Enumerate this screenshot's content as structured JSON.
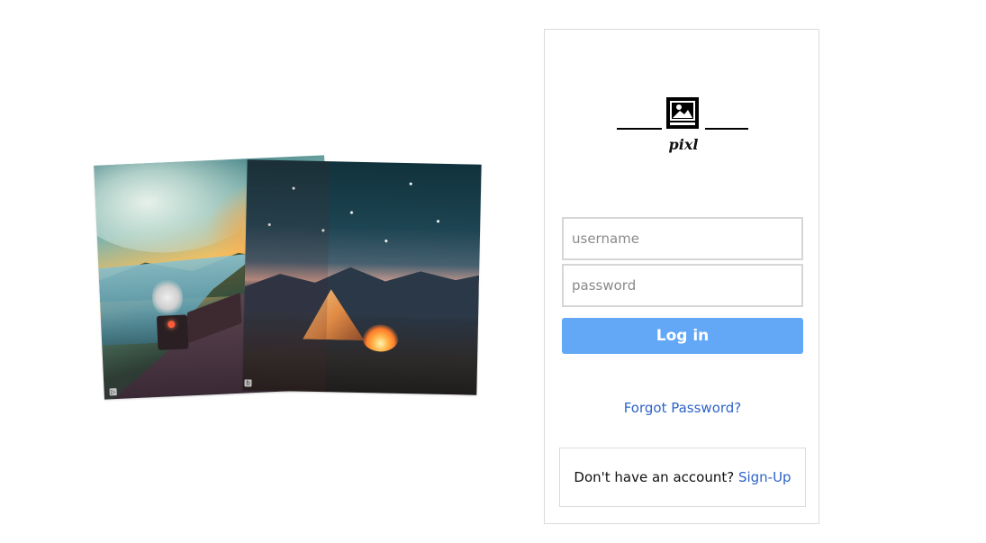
{
  "app": {
    "name": "pixl"
  },
  "login": {
    "username_placeholder": "username",
    "password_placeholder": "password",
    "login_button": "Log in",
    "forgot_password": "Forgot Password?",
    "signup_prompt": "Don't have an account?",
    "signup_link": "Sign-Up"
  },
  "images": [
    {
      "name": "train-landscape-illustration"
    },
    {
      "name": "camping-night-illustration"
    }
  ],
  "colors": {
    "primary_button": "#62a8f6",
    "link": "#2e63c9",
    "border": "#dbdbdb"
  }
}
